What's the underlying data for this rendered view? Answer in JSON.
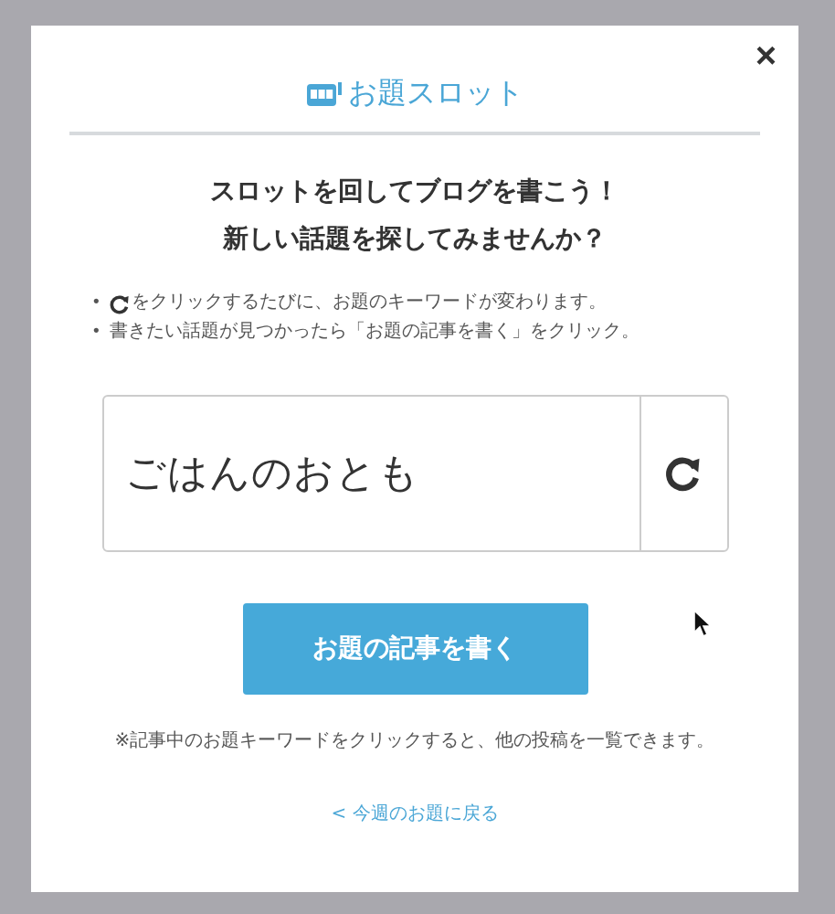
{
  "dialog": {
    "close": "×",
    "title": "お題スロット",
    "heading": [
      "スロットを回してブログを書こう！",
      "新しい話題を探してみませんか？"
    ],
    "instructions": [
      {
        "kind": "refresh",
        "bullet": "•",
        "text": "をクリックするたびに、お題のキーワードが変わります。"
      },
      {
        "kind": "plain",
        "bullet": "•",
        "text": "書きたい話題が見つかったら「お題の記事を書く」をクリック。"
      }
    ],
    "slot": {
      "keyword": "ごはんのおとも"
    },
    "write_button": "お題の記事を書く",
    "note": "※記事中のお題キーワードをクリックすると、他の投稿を一覧できます。",
    "back_link": "< 今週のお題に戻る"
  }
}
